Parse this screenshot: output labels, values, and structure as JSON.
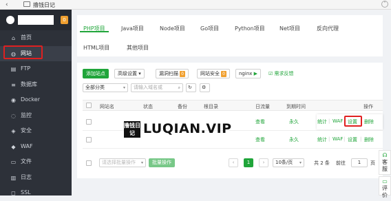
{
  "topbar": {
    "back_icon": "chevron-left",
    "crumb": "撸钱日记"
  },
  "sidebar": {
    "notify_count": "0",
    "items": [
      {
        "label": "首页",
        "icon": "home-icon",
        "glyph": "⌂"
      },
      {
        "label": "网站",
        "icon": "globe-icon",
        "glyph": "◍"
      },
      {
        "label": "FTP",
        "icon": "ftp-icon",
        "glyph": "▤"
      },
      {
        "label": "数据库",
        "icon": "database-icon",
        "glyph": "≡"
      },
      {
        "label": "Docker",
        "icon": "docker-icon",
        "glyph": "◉"
      },
      {
        "label": "监控",
        "icon": "monitor-icon",
        "glyph": "◌"
      },
      {
        "label": "安全",
        "icon": "shield-icon",
        "glyph": "◈"
      },
      {
        "label": "WAF",
        "icon": "waf-icon",
        "glyph": "◆"
      },
      {
        "label": "文件",
        "icon": "folder-icon",
        "glyph": "▭"
      },
      {
        "label": "日志",
        "icon": "log-icon",
        "glyph": "▥"
      },
      {
        "label": "SSL",
        "icon": "ssl-icon",
        "glyph": "◻"
      }
    ]
  },
  "tabs": {
    "php": "PHP项目",
    "java": "Java项目",
    "node": "Node项目",
    "go": "Go项目",
    "python": "Python项目",
    "net": "Net项目",
    "proxy": "反向代理",
    "html": "HTML项目",
    "other": "其他项目"
  },
  "toolbar": {
    "add_site": "添加站点",
    "advanced": "高级设置",
    "scan": "漏洞扫描",
    "scan_badge": "0",
    "site_security": "网站安全",
    "security_badge": "0",
    "nginx": "nginx",
    "feedback": "需求反馈"
  },
  "filters": {
    "category": "全部分类",
    "search_placeholder": "请输入域名或"
  },
  "table": {
    "headers": {
      "site": "网站名",
      "status": "状态",
      "backup": "备份",
      "root": "根目录",
      "flow": "日流量",
      "expire": "到期时间",
      "ops": "操作"
    },
    "rows": [
      {
        "flow": "查看",
        "expire": "永久",
        "stats": "统计",
        "waf": "WAF",
        "settings": "设置",
        "delete": "删除"
      },
      {
        "flow": "查看",
        "expire": "永久",
        "stats": "统计",
        "waf": "WAF",
        "settings": "设置",
        "delete": "删除"
      }
    ]
  },
  "watermark": {
    "box_text": "撸钱日记",
    "text": "LUQIAN.VIP"
  },
  "footer": {
    "batch_placeholder": "请选择批量操作",
    "batch_button": "批量操作",
    "page": "1",
    "per_page": "10条/页",
    "total": "共 2 条",
    "goto": "前往",
    "goto_value": "1",
    "page_suffix": "页"
  },
  "float": {
    "service": "客服",
    "review": "评价"
  },
  "colors": {
    "accent": "#20a53a",
    "highlight": "#e02020",
    "badge": "#f0a030",
    "sidebar": "#2d3139"
  }
}
